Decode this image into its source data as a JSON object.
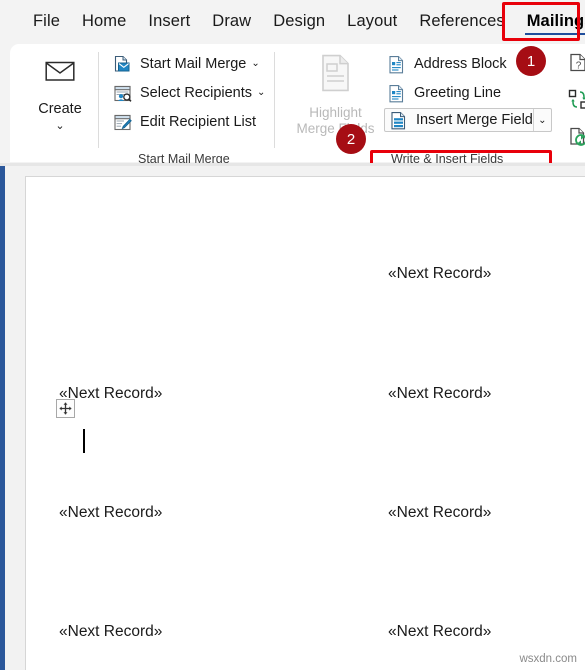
{
  "window": {
    "app": "Microsoft Word",
    "accent_blue": "#2b579a",
    "annotation_red": "#e8000a",
    "badge_red": "#a60d14"
  },
  "tabs": [
    {
      "label": "File",
      "active": false
    },
    {
      "label": "Home",
      "active": false
    },
    {
      "label": "Insert",
      "active": false
    },
    {
      "label": "Draw",
      "active": false
    },
    {
      "label": "Design",
      "active": false
    },
    {
      "label": "Layout",
      "active": false
    },
    {
      "label": "References",
      "active": false
    },
    {
      "label": "Mailings",
      "active": true
    }
  ],
  "ribbon": {
    "groups": [
      {
        "id": "create",
        "caption": "",
        "big_button": {
          "label": "Create",
          "icon": "envelope-icon",
          "has_dropdown": true,
          "chevron": "⌄"
        }
      },
      {
        "id": "start-mail-merge",
        "caption": "Start Mail Merge",
        "commands": [
          {
            "label": "Start Mail Merge",
            "icon": "start-mail-merge-icon",
            "has_dropdown": true,
            "chevron": "⌄",
            "disabled": false
          },
          {
            "label": "Select Recipients",
            "icon": "select-recipients-icon",
            "has_dropdown": true,
            "chevron": "⌄",
            "disabled": false
          },
          {
            "label": "Edit Recipient List",
            "icon": "edit-recipient-list-icon",
            "has_dropdown": false,
            "chevron": "",
            "disabled": false
          }
        ]
      },
      {
        "id": "highlight-merge-fields",
        "caption": "",
        "big_button": {
          "label": "Highlight\nMerge Fields",
          "label_line1": "Highlight",
          "label_line2": "Merge Fields",
          "icon": "highlight-merge-fields-icon",
          "disabled": true
        }
      },
      {
        "id": "write-and-insert-fields",
        "caption": "Write & Insert Fields",
        "commands": [
          {
            "label": "Address Block",
            "icon": "address-block-icon",
            "has_dropdown": false,
            "chevron": "",
            "highlighted": false
          },
          {
            "label": "Greeting Line",
            "icon": "greeting-line-icon",
            "has_dropdown": false,
            "chevron": "",
            "highlighted": false
          },
          {
            "label": "Insert Merge Field",
            "icon": "insert-merge-field-icon",
            "has_dropdown": true,
            "chevron": "⌄",
            "highlighted": true
          }
        ],
        "rail_icons": [
          {
            "name": "rules-icon",
            "label": "Rules"
          },
          {
            "name": "match-fields-icon",
            "label": "Match Fields"
          },
          {
            "name": "update-labels-icon",
            "label": "Update Labels"
          }
        ]
      }
    ]
  },
  "annotations": [
    {
      "id": "badge-1",
      "number": "1",
      "target": "Mailings tab"
    },
    {
      "id": "badge-2",
      "number": "2",
      "target": "Insert Merge Field"
    }
  ],
  "document": {
    "merge_field_text": "«Next Record»",
    "cells": [
      {
        "row": 1,
        "col": 1,
        "text": "",
        "has_caret": true
      },
      {
        "row": 1,
        "col": 2,
        "text": "«Next Record»",
        "has_caret": false
      },
      {
        "row": 2,
        "col": 1,
        "text": "«Next Record»",
        "has_caret": false
      },
      {
        "row": 2,
        "col": 2,
        "text": "«Next Record»",
        "has_caret": false
      },
      {
        "row": 3,
        "col": 1,
        "text": "«Next Record»",
        "has_caret": false
      },
      {
        "row": 3,
        "col": 2,
        "text": "«Next Record»",
        "has_caret": false
      },
      {
        "row": 4,
        "col": 1,
        "text": "«Next Record»",
        "has_caret": false
      },
      {
        "row": 4,
        "col": 2,
        "text": "«Next Record»",
        "has_caret": false
      }
    ],
    "table_move_handle": "table-move-handle"
  },
  "watermark": {
    "text": "wsxdn.com"
  }
}
